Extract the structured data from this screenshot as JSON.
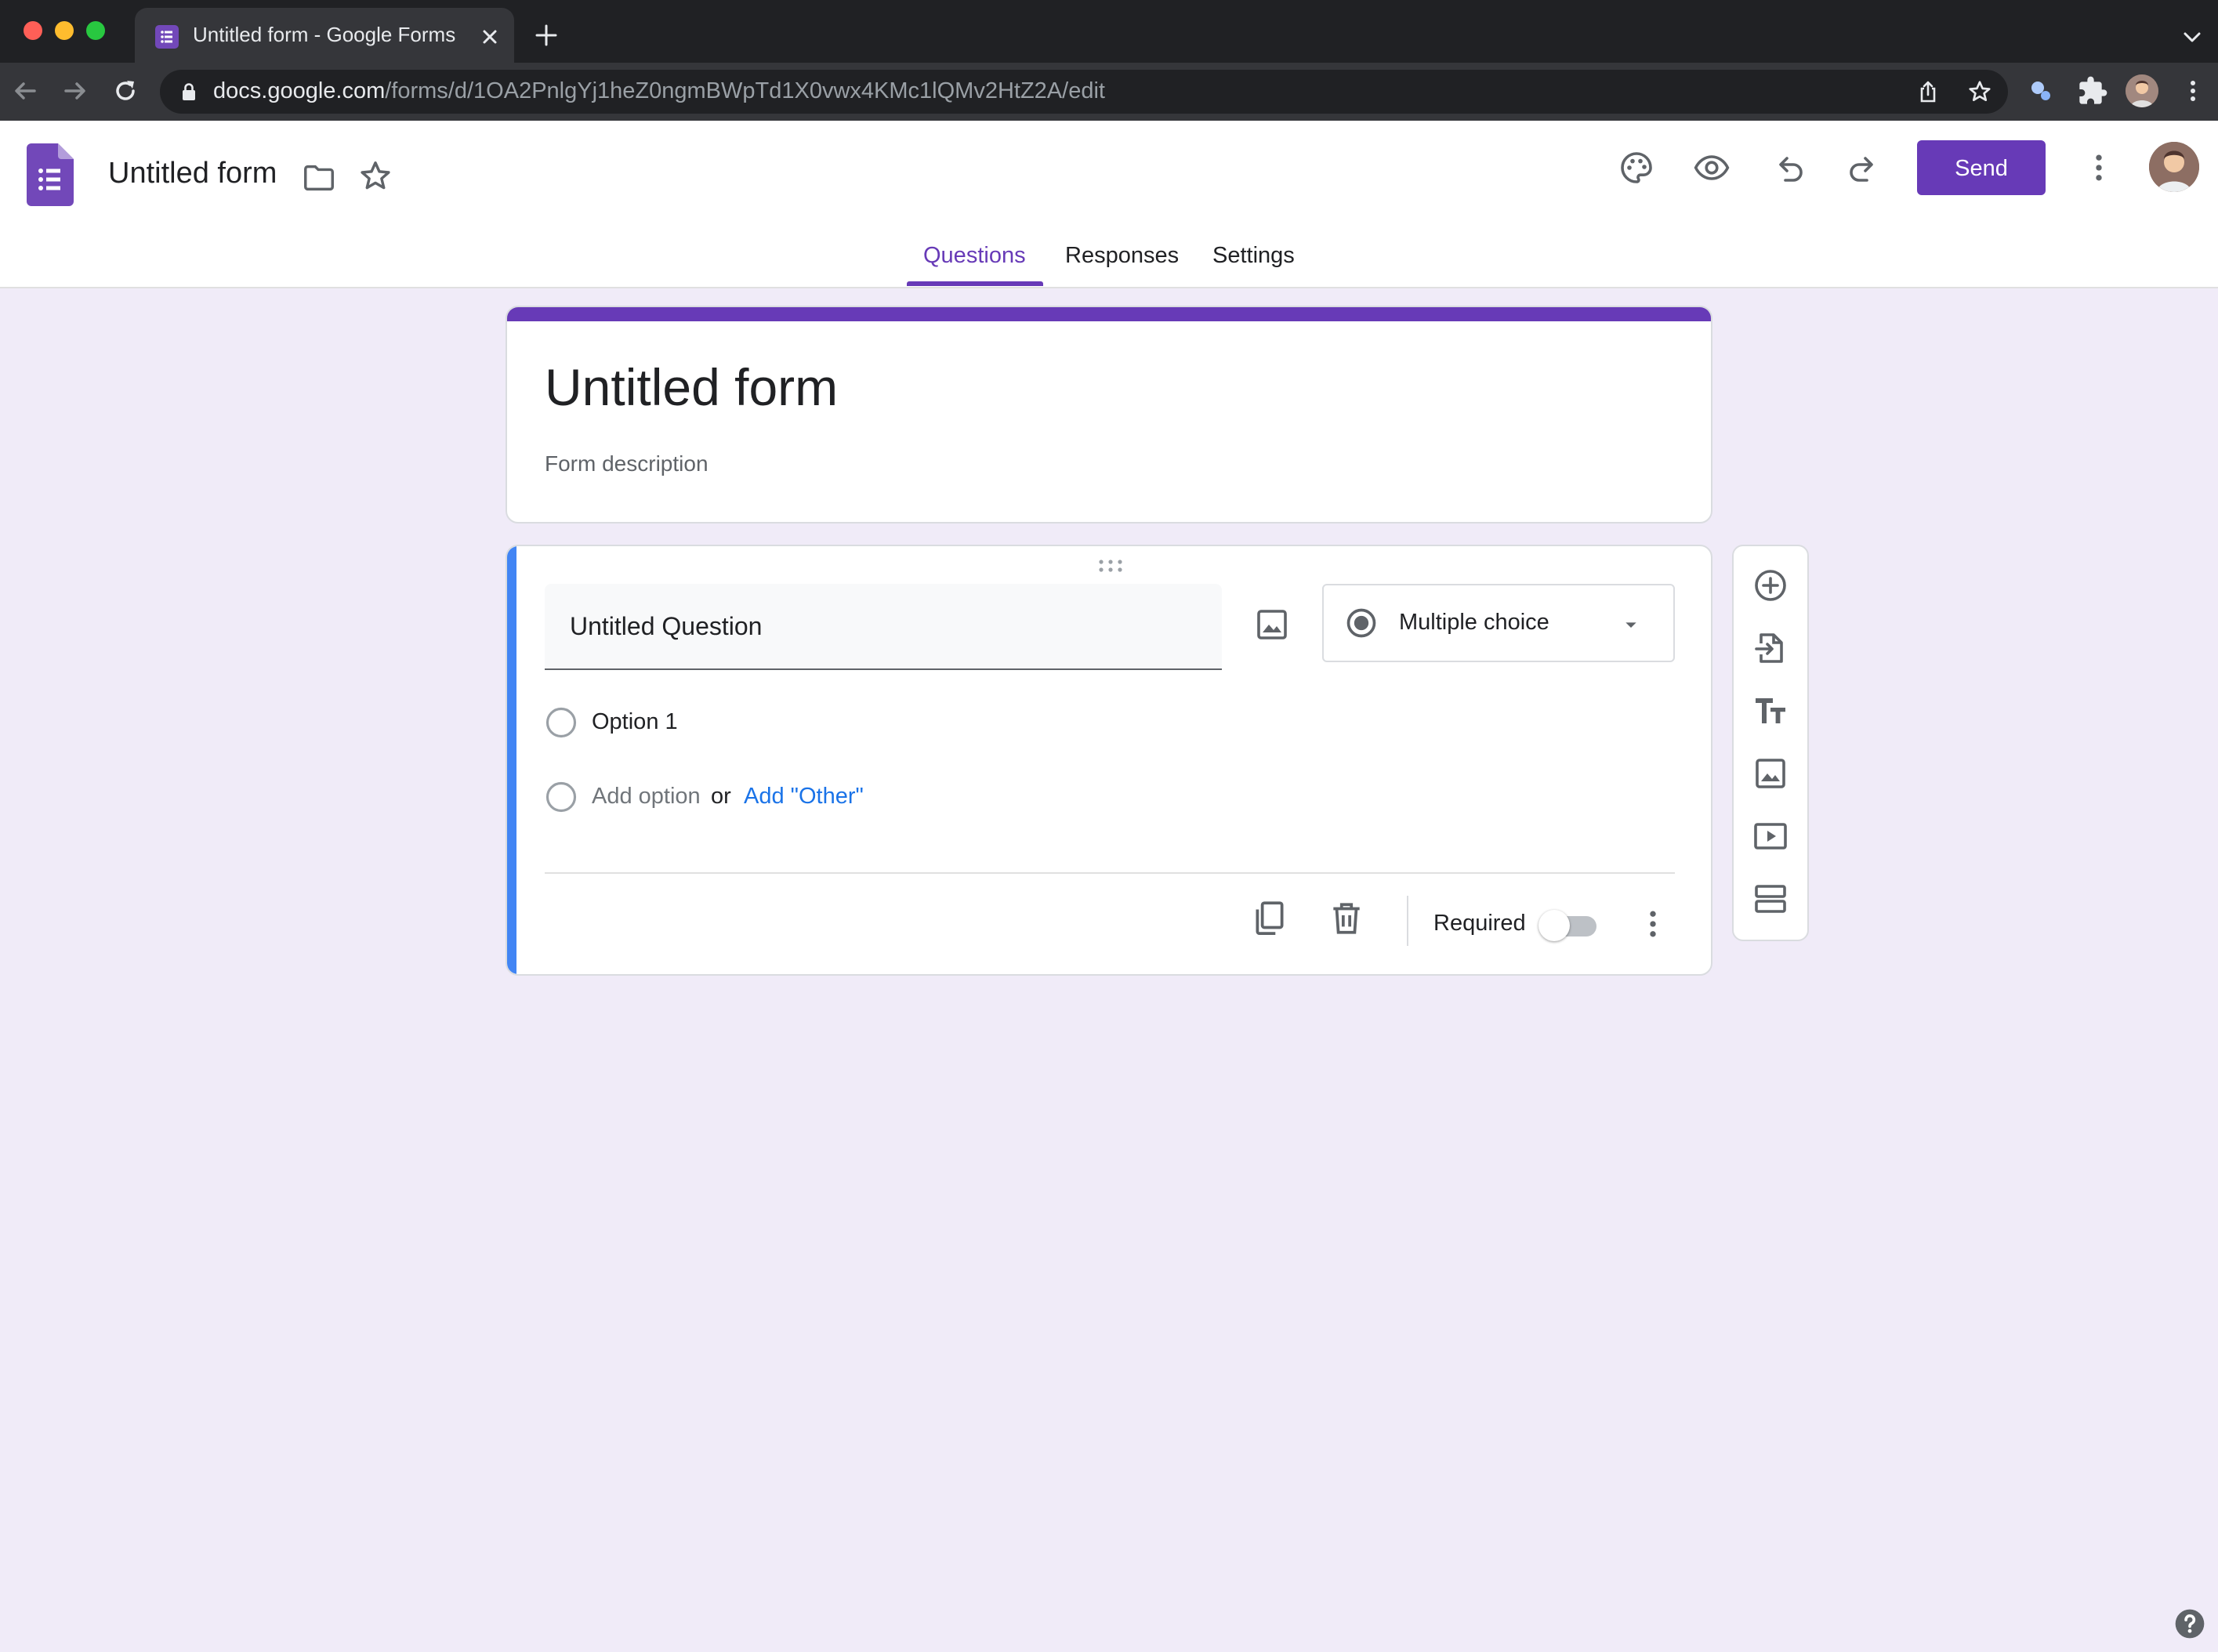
{
  "browser": {
    "tab_title": "Untitled form - Google Forms",
    "url_host": "docs.google.com",
    "url_path": "/forms/d/1OA2PnlgYj1heZ0ngmBWpTd1X0vwx4KMc1lQMv2HtZ2A/edit"
  },
  "header": {
    "doc_title": "Untitled form",
    "send_label": "Send",
    "icons": [
      "palette-icon",
      "preview-icon",
      "undo-icon",
      "redo-icon",
      "more-vert-icon"
    ]
  },
  "tabs": [
    {
      "label": "Questions",
      "active": true
    },
    {
      "label": "Responses",
      "active": false
    },
    {
      "label": "Settings",
      "active": false
    }
  ],
  "form": {
    "title": "Untitled form",
    "description_placeholder": "Form description"
  },
  "question": {
    "title": "Untitled Question",
    "type": "Multiple choice",
    "options": [
      "Option 1"
    ],
    "add_option_label": "Add option",
    "or_label": "or",
    "add_other_label": "Add \"Other\"",
    "required_label": "Required",
    "required": false
  },
  "side_toolbar": [
    "add-question-icon",
    "import-questions-icon",
    "add-title-icon",
    "add-image-icon",
    "add-video-icon",
    "add-section-icon"
  ],
  "colors": {
    "brand": "#673ab7",
    "question_accent": "#4285f4",
    "link": "#1a73e8",
    "page_background": "#f0ebf8"
  }
}
